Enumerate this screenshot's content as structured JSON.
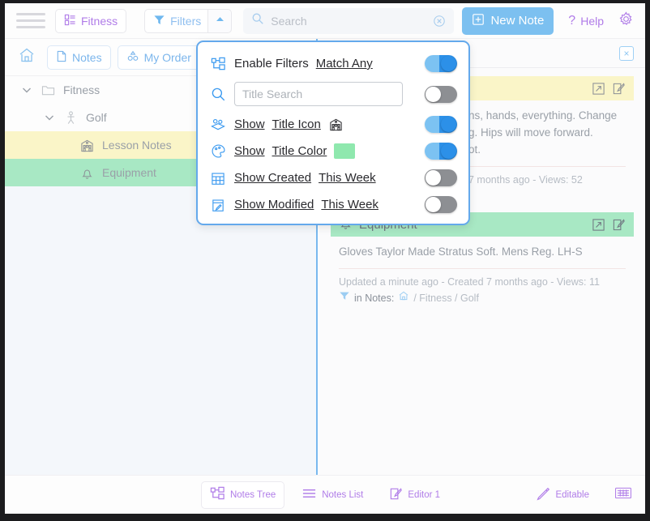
{
  "toolbar": {
    "menu_icon": "hamburger-icon",
    "workspace_label": "Fitness",
    "workspace_icon": "grid-layout-icon",
    "filters_label": "Filters",
    "filters_icon": "funnel-icon",
    "caret_icon": "chevron-up-icon",
    "search_icon": "search-icon",
    "search_value": "",
    "search_placeholder": "Search",
    "search_clear_icon": "clear-circle-icon",
    "new_note_label": "New Note",
    "new_note_icon": "plus-square-icon",
    "help_label": "Help",
    "help_icon": "question-mark-icon",
    "settings_icon": "gear-icon",
    "accent_blue": "#7cc0f0",
    "accent_purple": "#b07ce8"
  },
  "tree_toolbar": {
    "home_icon": "home-icon",
    "notes_label": "Notes",
    "notes_icon": "document-icon",
    "order_label": "My Order",
    "order_icon": "sort-order-icon"
  },
  "tree": {
    "rows": [
      {
        "label": "Fitness",
        "icon": "folder-icon",
        "twisty": "chevron-down-icon",
        "level": 1,
        "color": "none"
      },
      {
        "label": "Golf",
        "icon": "person-icon",
        "twisty": "chevron-down-icon",
        "level": 2,
        "color": "none"
      },
      {
        "label": "Lesson Notes",
        "icon": "building-icon",
        "twisty": "",
        "level": 3,
        "color": "yellow"
      },
      {
        "label": "Equipment",
        "icon": "bell-icon",
        "twisty": "",
        "level": 3,
        "color": "green"
      }
    ]
  },
  "filter_popup": {
    "rows": [
      {
        "icon": "tree-structure-icon",
        "label": "Enable Filters",
        "value_label": "Match Any",
        "toggle": "on",
        "kind": "text"
      },
      {
        "icon": "search-icon",
        "label": "",
        "input_value": "",
        "input_placeholder": "Title Search",
        "toggle": "off",
        "kind": "input"
      },
      {
        "icon": "palette-stack-icon",
        "label": "Show",
        "value_label": "Title Icon",
        "badge_icon": "building-icon",
        "toggle": "on",
        "kind": "icon-badge"
      },
      {
        "icon": "palette-icon",
        "label": "Show",
        "value_label": "Title Color",
        "swatch_color": "#8fe8ae",
        "toggle": "on",
        "kind": "swatch"
      },
      {
        "icon": "calendar-icon",
        "label": "Show Created",
        "value_label": "This Week",
        "toggle": "off",
        "kind": "text"
      },
      {
        "icon": "calendar-edit-icon",
        "label": "Show Modified",
        "value_label": "This Week",
        "toggle": "off",
        "kind": "text"
      }
    ]
  },
  "right_pane": {
    "close_icon": "close-icon",
    "cards": [
      {
        "title": "",
        "title_icon": "building-icon",
        "color": "yellow",
        "open_icon": "open-external-icon",
        "edit_icon": "edit-pencil-icon",
        "body": "ns, hands, everything. Change\ng. Hips will move forward.\not.",
        "meta": "7 months ago - Views: 52",
        "location_prefix": "",
        "location_icon": "",
        "location_path": ""
      },
      {
        "title": "Equipment",
        "title_icon": "bell-icon",
        "color": "green",
        "open_icon": "open-external-icon",
        "edit_icon": "edit-pencil-icon",
        "body": "Gloves Taylor Made Stratus Soft. Mens Reg. LH-S",
        "meta": "Updated a minute ago - Created 7 months ago - Views: 11",
        "location_prefix": "in Notes:",
        "location_icon": "funnel-icon",
        "location_home_icon": "home-icon",
        "location_path": "/ Fitness / Golf"
      }
    ]
  },
  "bottom_bar": {
    "notes_tree_label": "Notes Tree",
    "notes_tree_icon": "tree-structure-icon",
    "notes_list_label": "Notes List",
    "notes_list_icon": "list-lines-icon",
    "editor_label": "Editor 1",
    "editor_icon": "edit-pencil-icon",
    "editable_label": "Editable",
    "editable_icon": "pencil-icon",
    "keyboard_icon": "keyboard-icon"
  }
}
